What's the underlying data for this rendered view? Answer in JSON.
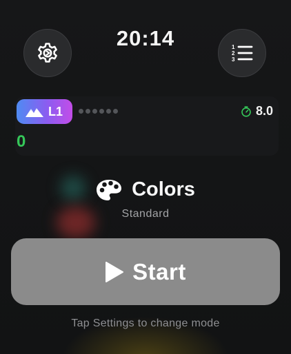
{
  "header": {
    "time": "20:14",
    "settings_icon": "gear-icon",
    "list_icon": "numbered-list-icon"
  },
  "level": {
    "label": "L1",
    "icon": "mountain-icon",
    "progress_dots_total": 6,
    "progress_dots_filled": 0,
    "timer_icon": "timer-icon",
    "timer_value": "8.0",
    "score": "0",
    "score_color": "#35c759"
  },
  "mode": {
    "icon": "palette-icon",
    "name": "Colors",
    "subtitle": "Standard"
  },
  "start": {
    "icon": "play-icon",
    "label": "Start"
  },
  "hint": "Tap Settings to change mode"
}
